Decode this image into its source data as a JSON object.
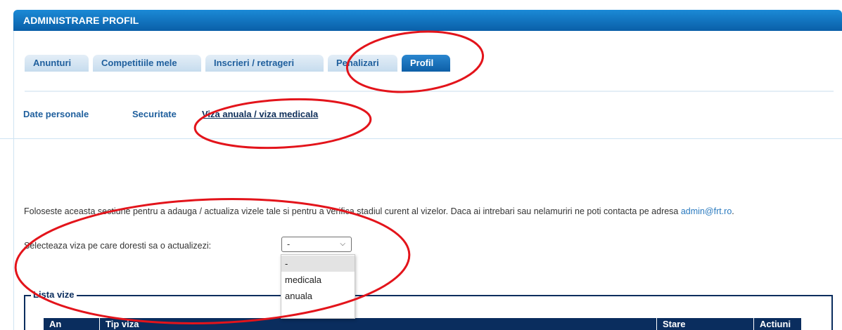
{
  "header": {
    "title": "ADMINISTRARE PROFIL"
  },
  "tabs": [
    {
      "label": "Anunturi",
      "active": false
    },
    {
      "label": "Competitiile mele",
      "active": false
    },
    {
      "label": "Inscrieri / retrageri",
      "active": false
    },
    {
      "label": "Penalizari",
      "active": false
    },
    {
      "label": "Profil",
      "active": true
    }
  ],
  "subnav": {
    "date_personale": "Date personale",
    "securitate": "Securitate",
    "viza": "Viza anuala / viza medicala"
  },
  "intro": {
    "text": "Foloseste aceasta sectiune pentru a adauga / actualiza vizele tale si pentru a verifica stadiul curent al vizelor. Daca ai intrebari sau nelamuriri ne poti contacta pe adresa ",
    "email": "admin@frt.ro",
    "suffix": "."
  },
  "select": {
    "label": "Selecteaza viza pe care doresti sa o actualizezi:",
    "value": "-",
    "options": [
      "-",
      "medicala",
      "anuala"
    ]
  },
  "list": {
    "legend": "Lista vize",
    "columns": [
      "An",
      "Tip viza",
      "Stare",
      "Actiuni"
    ]
  },
  "colors": {
    "header_blue": "#0a5fa8",
    "tab_text": "#1f5f9d",
    "dark_navy": "#0a2d5e",
    "annotation_red": "#e3141b"
  }
}
